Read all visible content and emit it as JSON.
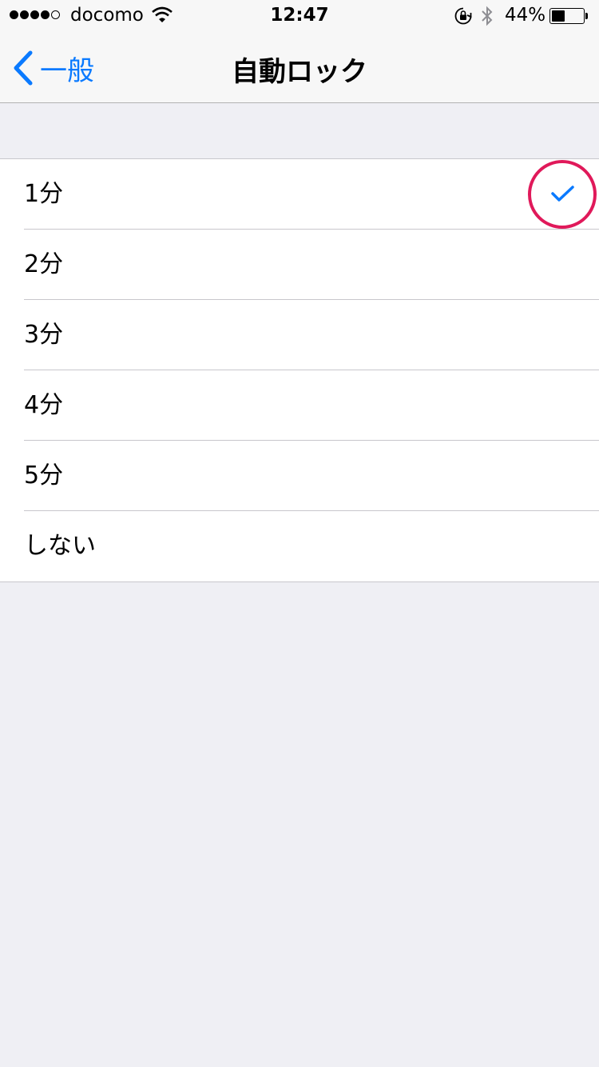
{
  "status_bar": {
    "signal_bars_filled": 4,
    "signal_bars_total": 5,
    "carrier": "docomo",
    "time": "12:47",
    "battery_percent": "44%",
    "battery_level": 0.44,
    "icons": [
      "wifi-icon",
      "orientation-lock-icon",
      "bluetooth-icon",
      "battery-icon"
    ]
  },
  "nav": {
    "back_label": "一般",
    "title": "自動ロック"
  },
  "options": [
    {
      "label": "1分",
      "selected": true
    },
    {
      "label": "2分",
      "selected": false
    },
    {
      "label": "3分",
      "selected": false
    },
    {
      "label": "4分",
      "selected": false
    },
    {
      "label": "5分",
      "selected": false
    },
    {
      "label": "しない",
      "selected": false
    }
  ],
  "colors": {
    "accent": "#0a7aff",
    "highlight": "#e0195a",
    "background": "#efeff4"
  }
}
